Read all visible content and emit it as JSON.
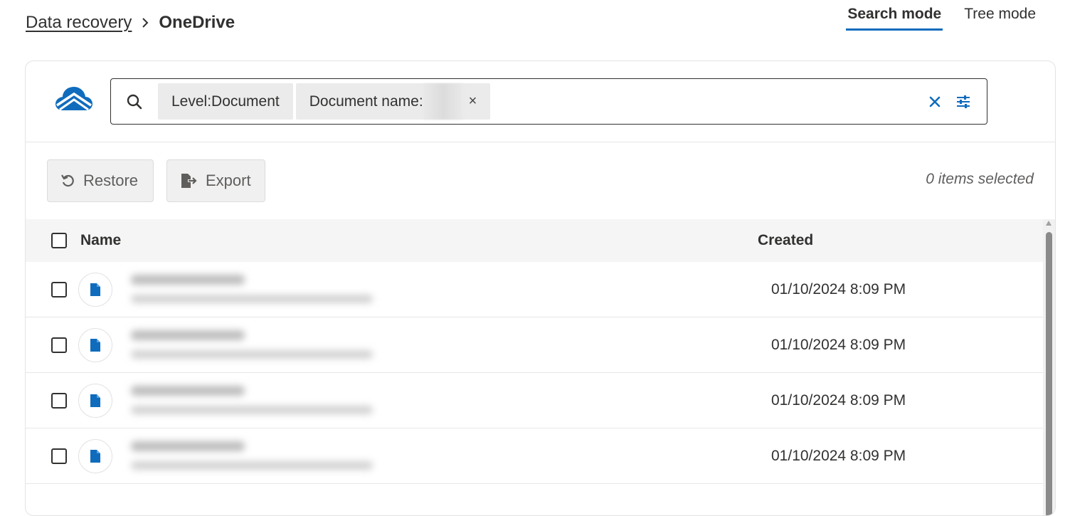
{
  "breadcrumb": {
    "parent": "Data recovery",
    "current": "OneDrive"
  },
  "modes": {
    "search": "Search mode",
    "tree": "Tree mode",
    "active": "search"
  },
  "search": {
    "chips": [
      {
        "label": "Level:Document"
      },
      {
        "label": "Document name:"
      }
    ]
  },
  "toolbar": {
    "restore_label": "Restore",
    "export_label": "Export",
    "selected_count": "0 items selected"
  },
  "table": {
    "columns": {
      "name": "Name",
      "created": "Created"
    },
    "rows": [
      {
        "created": "01/10/2024 8:09 PM"
      },
      {
        "created": "01/10/2024 8:09 PM"
      },
      {
        "created": "01/10/2024 8:09 PM"
      },
      {
        "created": "01/10/2024 8:09 PM"
      }
    ]
  },
  "colors": {
    "accent": "#0f6cbd",
    "file_icon": "#0f6cbd"
  },
  "icons": {
    "logo": "onedrive-cloud-icon",
    "search": "search-icon",
    "clear": "close-icon",
    "filters": "filter-sliders-icon",
    "restore": "undo-icon",
    "export": "export-file-icon",
    "file": "document-icon"
  }
}
